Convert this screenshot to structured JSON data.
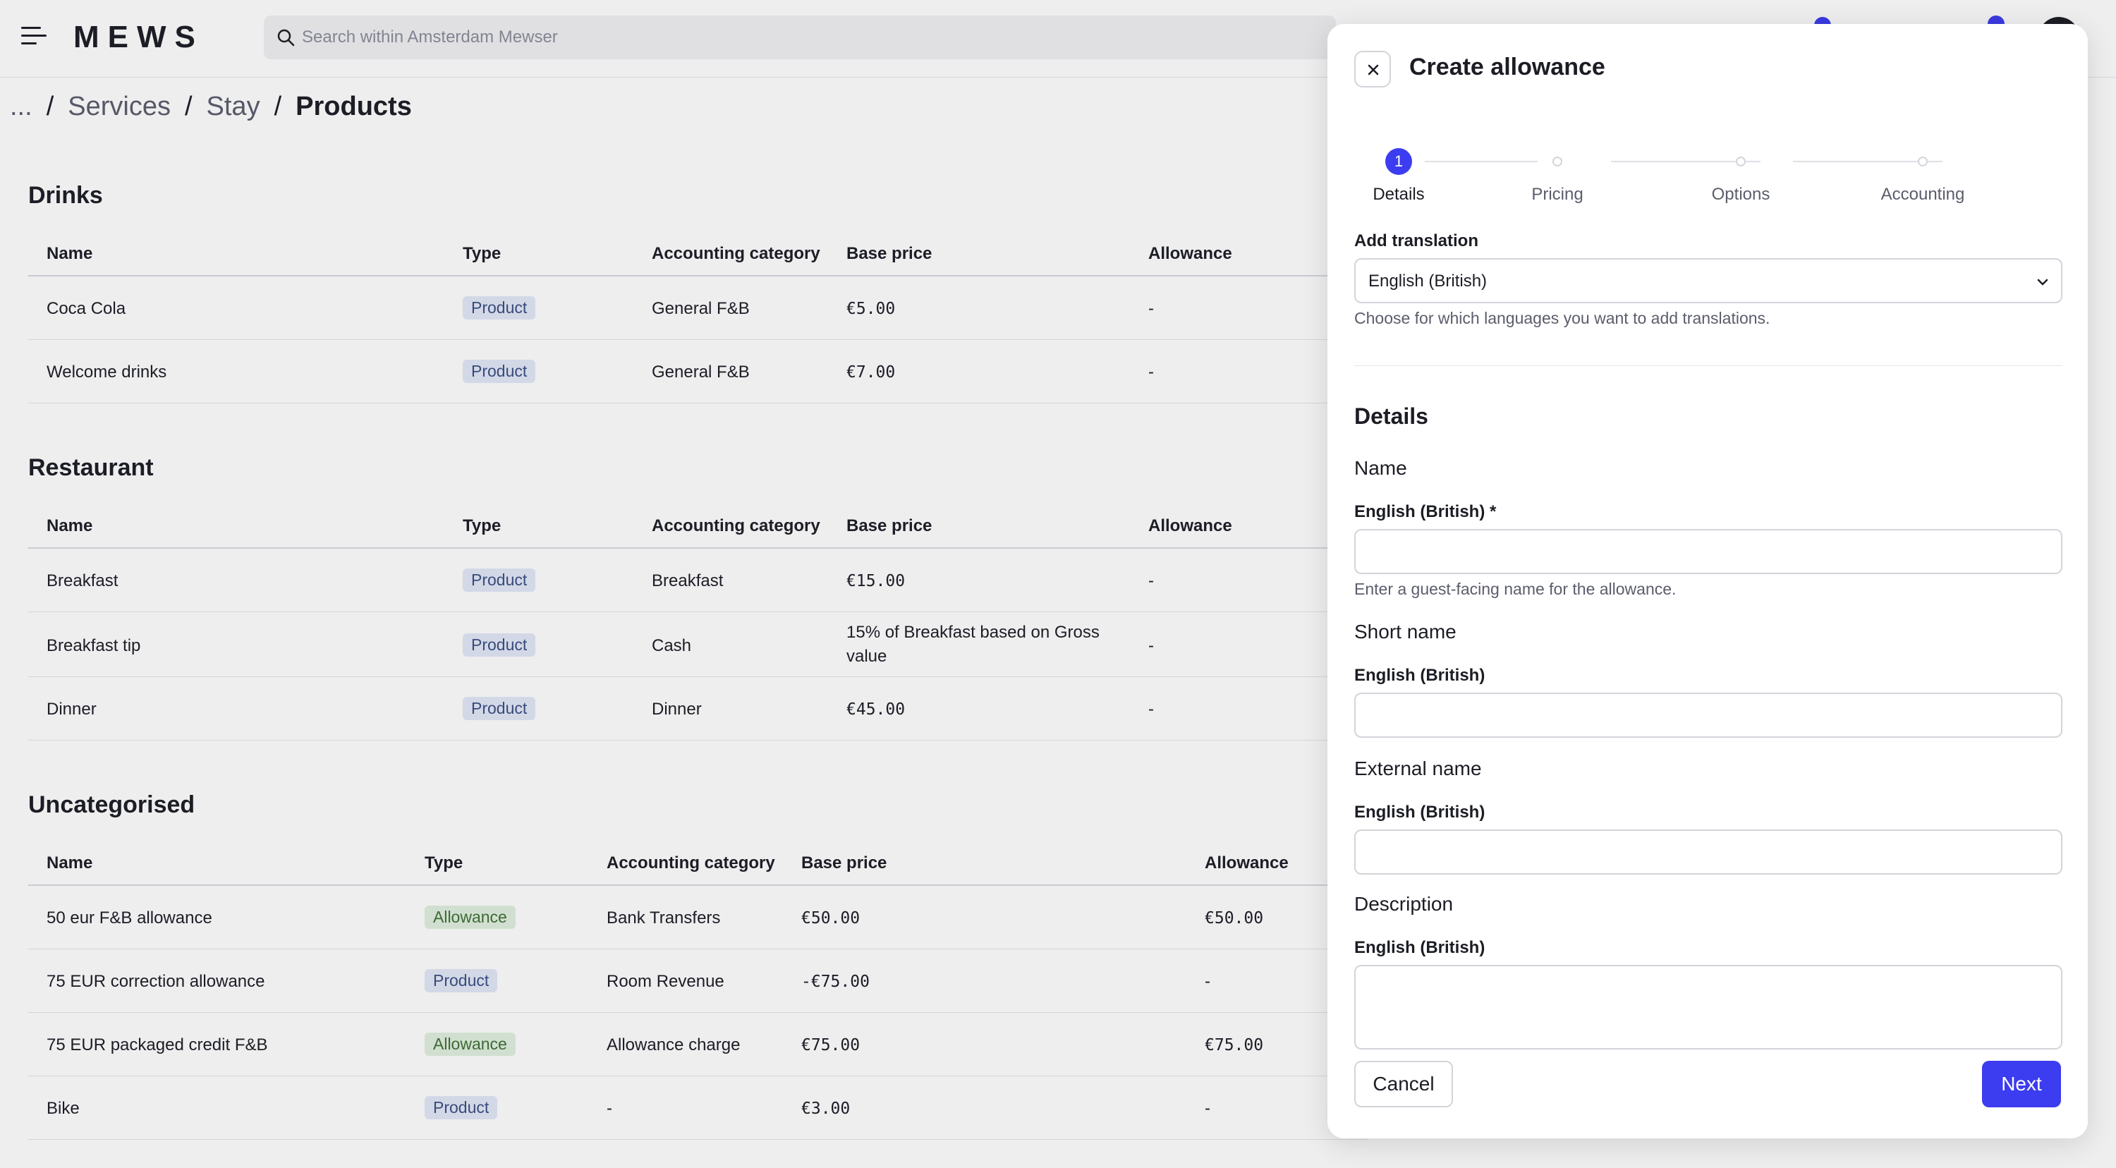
{
  "app": {
    "logo": "MEWS",
    "search_placeholder": "Search within Amsterdam Mewser"
  },
  "breadcrumb": {
    "ellipsis": "...",
    "items": [
      "Services",
      "Stay"
    ],
    "current": "Products",
    "separator": "/"
  },
  "sections": [
    {
      "title": "Drinks",
      "columns": [
        "Name",
        "Type",
        "Accounting category",
        "Base price",
        "Allowance"
      ],
      "rows": [
        {
          "name": "Coca Cola",
          "type": "Product",
          "category": "General F&B",
          "price": "€5.00",
          "allowance": "-"
        },
        {
          "name": "Welcome drinks",
          "type": "Product",
          "category": "General F&B",
          "price": "€7.00",
          "allowance": "-"
        }
      ]
    },
    {
      "title": "Restaurant",
      "columns": [
        "Name",
        "Type",
        "Accounting category",
        "Base price",
        "Allowance"
      ],
      "rows": [
        {
          "name": "Breakfast",
          "type": "Product",
          "category": "Breakfast",
          "price": "€15.00",
          "allowance": "-"
        },
        {
          "name": "Breakfast tip",
          "type": "Product",
          "category": "Cash",
          "price": "15% of Breakfast based on Gross value",
          "allowance": "-"
        },
        {
          "name": "Dinner",
          "type": "Product",
          "category": "Dinner",
          "price": "€45.00",
          "allowance": "-"
        }
      ]
    },
    {
      "title": "Uncategorised",
      "columns": [
        "Name",
        "Type",
        "Accounting category",
        "Base price",
        "Allowance"
      ],
      "rows": [
        {
          "name": "50 eur F&B allowance",
          "type": "Allowance",
          "category": "Bank Transfers",
          "price": "€50.00",
          "allowance": "€50.00"
        },
        {
          "name": "75 EUR correction allowance",
          "type": "Product",
          "category": "Room Revenue",
          "price": "-€75.00",
          "allowance": "-"
        },
        {
          "name": "75 EUR packaged credit F&B",
          "type": "Allowance",
          "category": "Allowance charge",
          "price": "€75.00",
          "allowance": "€75.00"
        },
        {
          "name": "Bike",
          "type": "Product",
          "category": "-",
          "price": "€3.00",
          "allowance": "-"
        }
      ]
    }
  ],
  "modal": {
    "title": "Create allowance",
    "steps": [
      {
        "number": "1",
        "label": "Details",
        "active": true
      },
      {
        "number": "",
        "label": "Pricing",
        "active": false
      },
      {
        "number": "",
        "label": "Options",
        "active": false
      },
      {
        "number": "",
        "label": "Accounting",
        "active": false
      }
    ],
    "translation": {
      "label": "Add translation",
      "value": "English (British)",
      "help": "Choose for which languages you want to add translations."
    },
    "details_heading": "Details",
    "name": {
      "heading": "Name",
      "label": "English (British) *",
      "value": "",
      "help": "Enter a guest-facing name for the allowance."
    },
    "short_name": {
      "heading": "Short name",
      "label": "English (British)",
      "value": ""
    },
    "external_name": {
      "heading": "External name",
      "label": "English (British)",
      "value": ""
    },
    "description": {
      "heading": "Description",
      "label": "English (British)",
      "value": ""
    },
    "cancel_label": "Cancel",
    "next_label": "Next"
  },
  "colors": {
    "accent": "#3c3cf0",
    "product_badge_bg": "#e2e8f7",
    "allowance_badge_bg": "#e0efde"
  }
}
